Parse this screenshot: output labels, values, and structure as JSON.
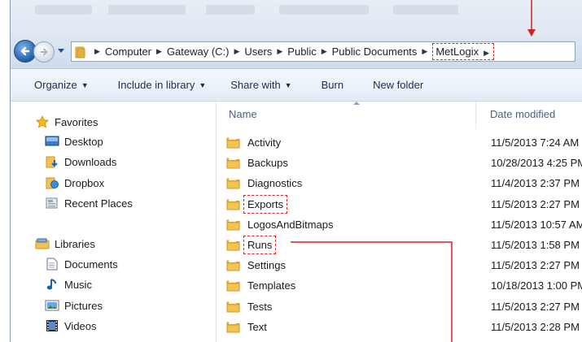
{
  "address": {
    "crumbs": [
      "Computer",
      "Gateway (C:)",
      "Users",
      "Public",
      "Public Documents",
      "MetLogix"
    ]
  },
  "toolbar": {
    "organize": "Organize",
    "include_in_library": "Include in library",
    "share_with": "Share with",
    "burn": "Burn",
    "new_folder": "New folder"
  },
  "nav": {
    "favorites": {
      "header": "Favorites",
      "items": [
        "Desktop",
        "Downloads",
        "Dropbox",
        "Recent Places"
      ]
    },
    "libraries": {
      "header": "Libraries",
      "items": [
        "Documents",
        "Music",
        "Pictures",
        "Videos"
      ]
    }
  },
  "columns": {
    "name": "Name",
    "date_modified": "Date modified"
  },
  "files": [
    {
      "name": "Activity",
      "date": "11/5/2013 7:24 AM"
    },
    {
      "name": "Backups",
      "date": "10/28/2013 4:25 PM"
    },
    {
      "name": "Diagnostics",
      "date": "11/4/2013 2:37 PM"
    },
    {
      "name": "Exports",
      "date": "11/5/2013 2:27 PM",
      "highlighted": true
    },
    {
      "name": "LogosAndBitmaps",
      "date": "11/5/2013 10:57 AM"
    },
    {
      "name": "Runs",
      "date": "11/5/2013 1:58 PM",
      "highlighted": true
    },
    {
      "name": "Settings",
      "date": "11/5/2013 2:27 PM"
    },
    {
      "name": "Templates",
      "date": "10/18/2013 1:00 PM"
    },
    {
      "name": "Tests",
      "date": "11/5/2013 2:27 PM"
    },
    {
      "name": "Text",
      "date": "11/5/2013 2:28 PM"
    }
  ],
  "colors": {
    "annotation": "#d22222",
    "folder": "#e8b43c",
    "header_text": "#4c607a"
  }
}
